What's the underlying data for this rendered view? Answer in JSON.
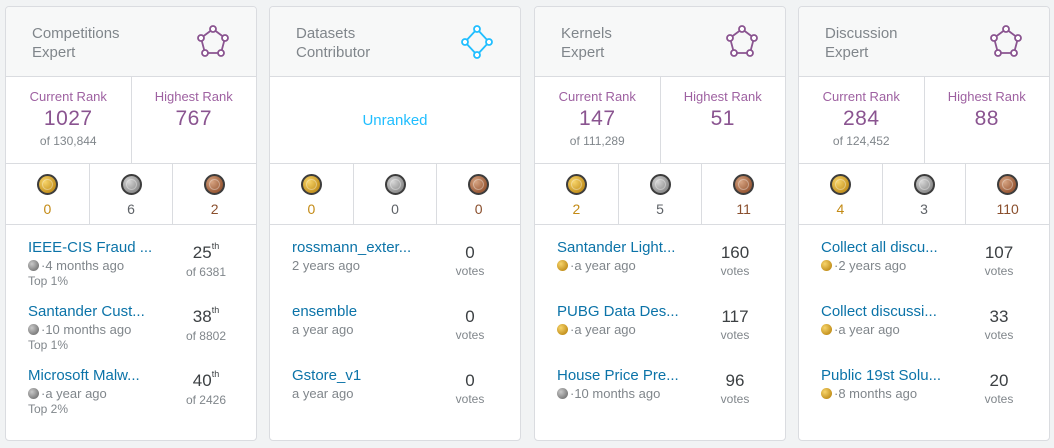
{
  "colors": {
    "kaggle_blue": "#20beff",
    "expert_purple": "#8a5490",
    "link": "#0b73a8"
  },
  "cards": [
    {
      "title": "Competitions\nExpert",
      "icon": "expert-tier-icon",
      "ranked": true,
      "current_rank_label": "Current Rank",
      "current_rank": "1027",
      "current_of": "of 130,844",
      "highest_rank_label": "Highest Rank",
      "highest_rank": "767",
      "medals": {
        "gold": "0",
        "silver": "6",
        "bronze": "2"
      },
      "items": [
        {
          "title": "IEEE-CIS Fraud ...",
          "medal": "silver",
          "time": "·4 months ago",
          "top": "Top 1%",
          "pos": "25",
          "pos_sup": "th",
          "of": "of 6381"
        },
        {
          "title": "Santander Cust...",
          "medal": "silver",
          "time": "·10 months ago",
          "top": "Top 1%",
          "pos": "38",
          "pos_sup": "th",
          "of": "of 8802"
        },
        {
          "title": "Microsoft Malw...",
          "medal": "silver",
          "time": "·a year ago",
          "top": "Top 2%",
          "pos": "40",
          "pos_sup": "th",
          "of": "of 2426"
        }
      ]
    },
    {
      "title": "Datasets\nContributor",
      "icon": "contributor-tier-icon",
      "ranked": false,
      "unranked_label": "Unranked",
      "medals": {
        "gold": "0",
        "silver": "0",
        "bronze": "0"
      },
      "items": [
        {
          "title": "rossmann_exter...",
          "medal": "",
          "time": "2 years ago",
          "votes": "0",
          "votes_label": "votes"
        },
        {
          "title": "ensemble",
          "medal": "",
          "time": "a year ago",
          "votes": "0",
          "votes_label": "votes"
        },
        {
          "title": "Gstore_v1",
          "medal": "",
          "time": "a year ago",
          "votes": "0",
          "votes_label": "votes"
        }
      ]
    },
    {
      "title": "Kernels\nExpert",
      "icon": "expert-tier-icon",
      "ranked": true,
      "current_rank_label": "Current Rank",
      "current_rank": "147",
      "current_of": "of 111,289",
      "highest_rank_label": "Highest Rank",
      "highest_rank": "51",
      "medals": {
        "gold": "2",
        "silver": "5",
        "bronze": "11"
      },
      "items": [
        {
          "title": "Santander Light...",
          "medal": "gold",
          "time": "·a year ago",
          "votes": "160",
          "votes_label": "votes"
        },
        {
          "title": "PUBG Data Des...",
          "medal": "gold",
          "time": "·a year ago",
          "votes": "117",
          "votes_label": "votes"
        },
        {
          "title": "House Price Pre...",
          "medal": "silver",
          "time": "·10 months ago",
          "votes": "96",
          "votes_label": "votes"
        }
      ]
    },
    {
      "title": "Discussion\nExpert",
      "icon": "expert-tier-icon",
      "ranked": true,
      "current_rank_label": "Current Rank",
      "current_rank": "284",
      "current_of": "of 124,452",
      "highest_rank_label": "Highest Rank",
      "highest_rank": "88",
      "medals": {
        "gold": "4",
        "silver": "3",
        "bronze": "110"
      },
      "items": [
        {
          "title": "Collect all discu...",
          "medal": "gold",
          "time": "·2 years ago",
          "votes": "107",
          "votes_label": "votes"
        },
        {
          "title": "Collect discussi...",
          "medal": "gold",
          "time": "·a year ago",
          "votes": "33",
          "votes_label": "votes"
        },
        {
          "title": "Public 19st Solu...",
          "medal": "gold",
          "time": "·8 months ago",
          "votes": "20",
          "votes_label": "votes"
        }
      ]
    }
  ]
}
